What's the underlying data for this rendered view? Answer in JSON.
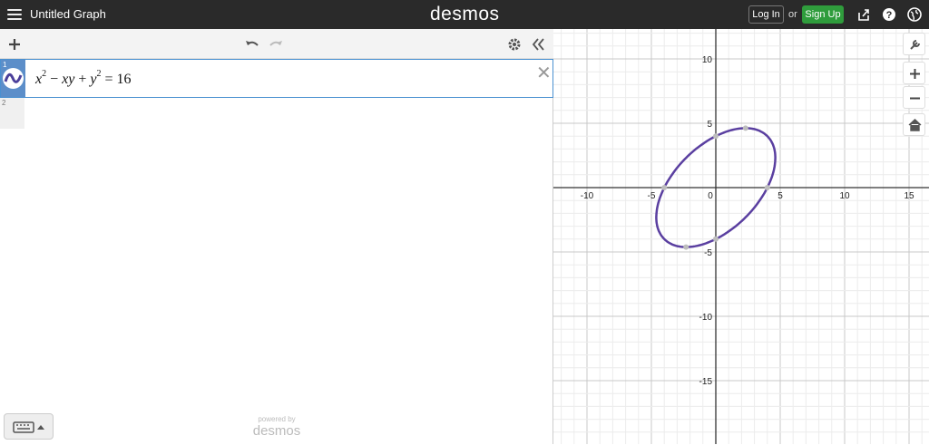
{
  "app": {
    "title": "Untitled Graph",
    "brand": "desmos",
    "login_label": "Log In",
    "or_text": "or",
    "signup_label": "Sign Up"
  },
  "expressions": {
    "items": [
      {
        "index": "1",
        "latex_display": "x^2 − xy + y^2 = 16"
      },
      {
        "index": "2",
        "latex_display": ""
      }
    ]
  },
  "footer": {
    "powered_by": "powered by",
    "logo": "desmos"
  },
  "graph": {
    "x_ticks": [
      "-10",
      "-5",
      "0",
      "5",
      "10",
      "15"
    ],
    "y_ticks": [
      "10",
      "5",
      "-5",
      "-10",
      "-15"
    ],
    "curve_color": "#5a3fa0",
    "points": [
      {
        "x": -4.0,
        "y": 0
      },
      {
        "x": 4.0,
        "y": 0
      },
      {
        "x": 0,
        "y": 4.0
      },
      {
        "x": 0,
        "y": -4.0
      },
      {
        "x": 2.31,
        "y": 4.62
      },
      {
        "x": -2.31,
        "y": -4.62
      }
    ]
  },
  "colors": {
    "topbar": "#2a2a2a",
    "signup": "#2f9c3c",
    "expr_tab": "#5c8ec9"
  }
}
